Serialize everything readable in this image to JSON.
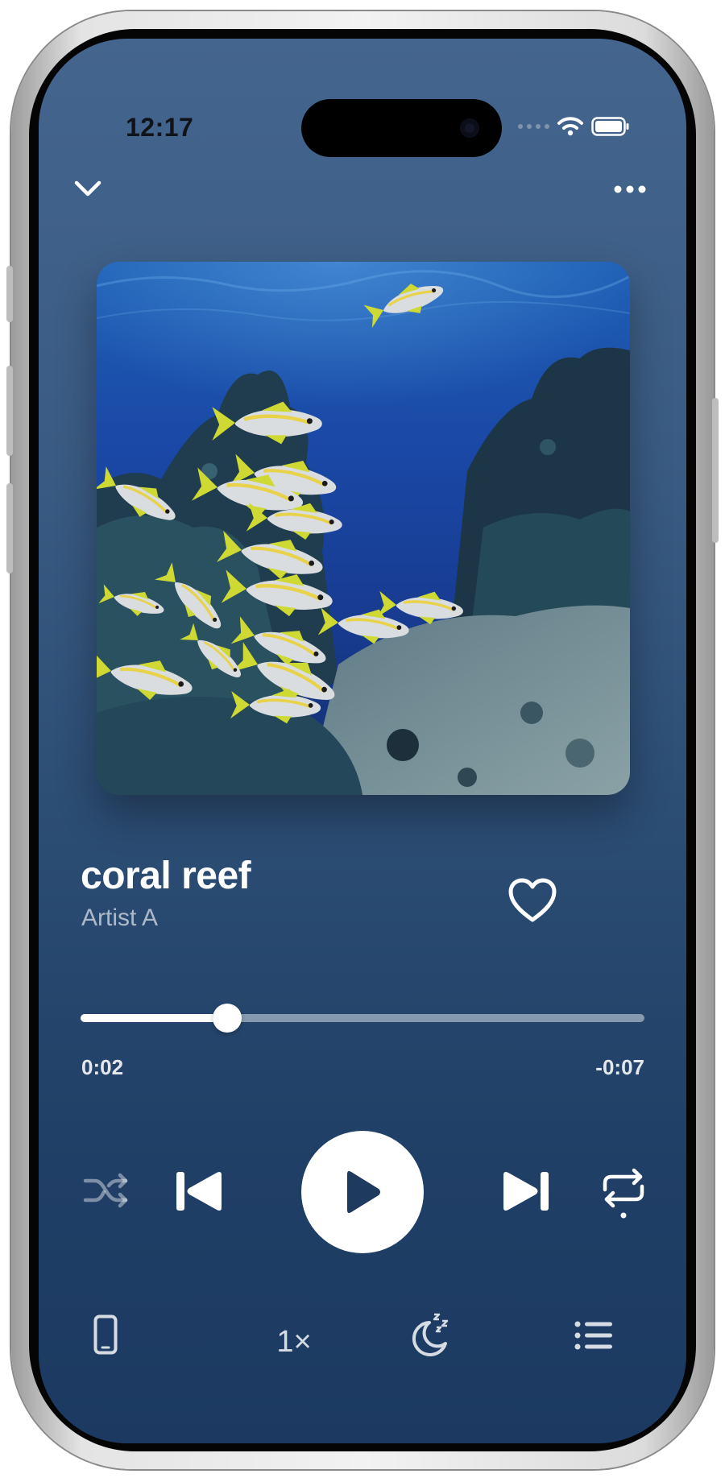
{
  "status_bar": {
    "time": "12:17"
  },
  "track": {
    "title": "coral reef",
    "artist": "Artist A",
    "favorite": false
  },
  "playback": {
    "elapsed": "0:02",
    "remaining": "-0:07",
    "progress_fraction": 0.26,
    "playing": false,
    "speed_label": "1×"
  },
  "icons": {
    "collapse": "chevron-down-icon",
    "more": "more-horizontal-icon",
    "favorite": "heart-icon",
    "shuffle": "shuffle-icon",
    "previous": "skip-previous-icon",
    "play": "play-icon",
    "next": "skip-next-icon",
    "repeat": "repeat-one-icon",
    "device": "phone-device-icon",
    "sleep": "sleep-timer-icon",
    "queue": "queue-list-icon"
  },
  "colors": {
    "background_top": "#44658e",
    "background_bottom": "#1c3a61",
    "foreground": "#ffffff"
  }
}
